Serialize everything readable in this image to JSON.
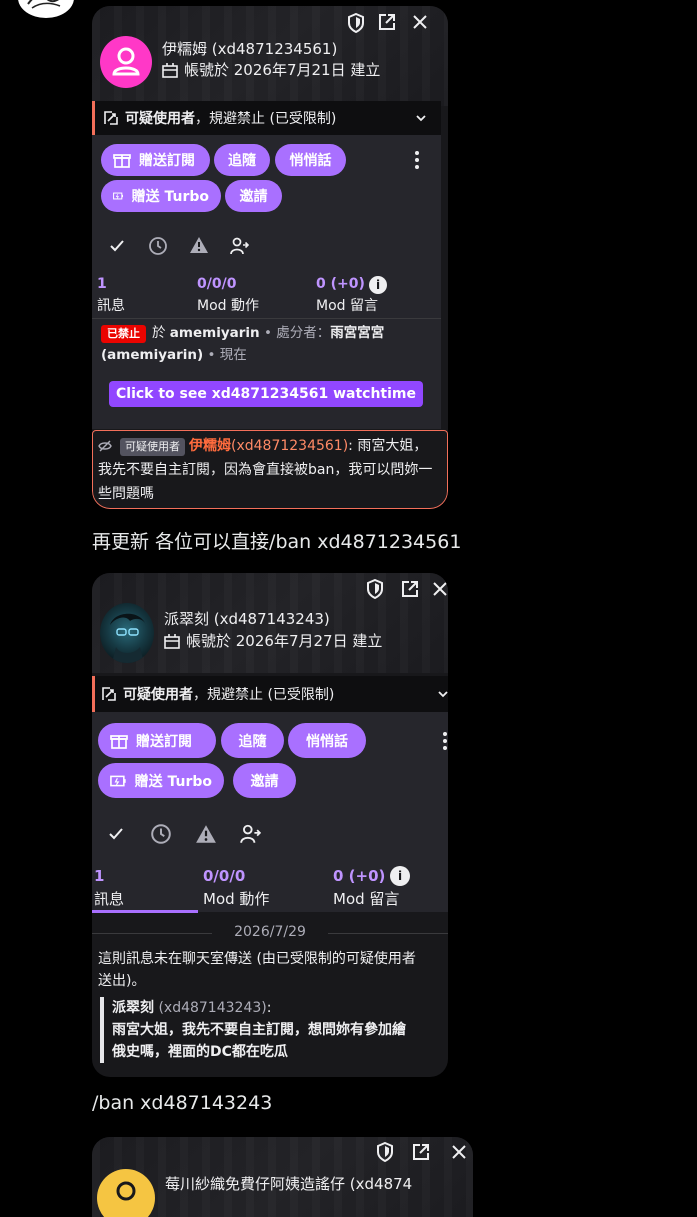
{
  "card1": {
    "display_name": "伊糯姆 (xd4871234561)",
    "created": "帳號於 2026年7月21日 建立",
    "banner_bold": "可疑使用者",
    "banner_rest": "，規避禁止 (已受限制)",
    "buttons": {
      "gift_sub": "贈送訂閱",
      "follow": "追隨",
      "whisper": "悄悄話",
      "gift_turbo": "贈送 Turbo",
      "invite": "邀請"
    },
    "stats": [
      {
        "num": "1",
        "label": "訊息"
      },
      {
        "num": "0/0/0",
        "label": "Mod 動作"
      },
      {
        "num": "0 (+0)",
        "label": "Mod 留言"
      }
    ],
    "ban": {
      "badge": "已禁止",
      "prefix": "於",
      "channel": "amemiyarin",
      "sep1": "• 處分者：",
      "moderator": "雨宮宮宮",
      "mod_login": "(amemiyarin)",
      "sep2": "• 現在"
    },
    "watchtime_label": "Click to see xd4871234561 watchtime",
    "chat": {
      "badge": "可疑使用者",
      "name": "伊糯姆",
      "login": "(xd4871234561)",
      "line1": ": 雨宮大姐，",
      "line2": "我先不要自主訂閱，因為會直接被ban，我可以問妳一",
      "line3": "些問題嗎"
    }
  },
  "tweet1": "再更新 各位可以直接/ban xd4871234561",
  "card2": {
    "display_name": "派翠刻 (xd487143243)",
    "created": "帳號於 2026年7月27日 建立",
    "banner_bold": "可疑使用者",
    "banner_rest": "，規避禁止 (已受限制)",
    "buttons": {
      "gift_sub": "贈送訂閱",
      "follow": "追隨",
      "whisper": "悄悄話",
      "gift_turbo": "贈送 Turbo",
      "invite": "邀請"
    },
    "stats": [
      {
        "num": "1",
        "label": "訊息"
      },
      {
        "num": "0/0/0",
        "label": "Mod 動作"
      },
      {
        "num": "0 (+0)",
        "label": "Mod 留言"
      }
    ],
    "date": "2026/7/29",
    "notice_line1": "這則訊息未在聊天室傳送 (由已受限制的可疑使用者",
    "notice_line2": "送出)。",
    "quote": {
      "name": "派翠刻",
      "login": "(xd487143243)",
      "colon": ":",
      "line1": "雨宮大姐，我先不要自主訂閱，想問妳有參加繪",
      "line2": "俄史嗎，裡面的DC都在吃瓜"
    }
  },
  "tweet2": "/ban xd487143243",
  "card3": {
    "display_name": "莓川紗織免費仔阿姨造謠仔 (xd4874"
  },
  "colors": {
    "accent": "#a970ff",
    "suspicious": "#f36f5a",
    "banned": "#eb0400"
  }
}
